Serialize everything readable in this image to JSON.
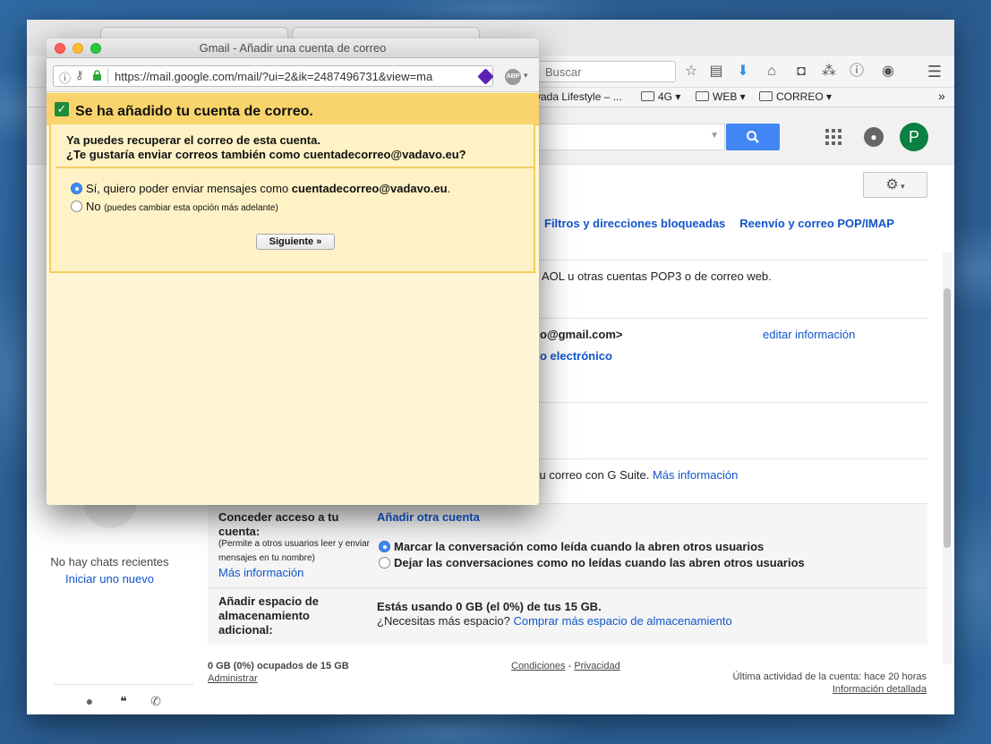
{
  "popup": {
    "title": "Gmail - Añadir una cuenta de correo",
    "url": "https://mail.google.com/mail/?ui=2&ik=2487496731&view=ma",
    "notice": "Se ha añadido tu cuenta de correo.",
    "question_line1": "Ya puedes recuperar el correo de esta cuenta.",
    "question_line2": "¿Te gustaría enviar correos también como cuentadecorreo@vadavo.eu?",
    "option_yes_prefix": "Sí, quiero poder enviar mensajes como ",
    "option_yes_email": "cuentadecorreo@vadavo.eu",
    "option_yes_suffix": ".",
    "option_no": "No",
    "option_no_note": "(puedes cambiar esta opción más adelante)",
    "next_button": "Siguiente »",
    "abp_label": "ABP"
  },
  "browser": {
    "search_placeholder": "Buscar",
    "bookmarks": {
      "item1": "vada Lifestyle – ...",
      "item2": "4G",
      "item3": "WEB",
      "item4": "CORREO"
    },
    "overflow": "»"
  },
  "gmail": {
    "avatar_letter": "P",
    "tabs": {
      "filters": "Filtros y direcciones bloqueadas",
      "forwarding": "Reenvío y correo POP/IMAP"
    },
    "accounts_text": "AOL u otras cuentas POP3 o de correo web.",
    "send_as_email": "o@gmail.com>",
    "edit_info": "editar información",
    "add_address": "o electrónico",
    "gsuite_text": " su correo con G Suite. ",
    "more_info": "Más información",
    "grant_access_label": "Conceder acceso a tu cuenta:",
    "grant_access_note": "(Permite a otros usuarios leer y enviar mensajes en tu nombre)",
    "grant_more_info": "Más información",
    "add_other_account": "Añadir otra cuenta",
    "mark_read": "Marcar la conversación como leída cuando la abren otros usuarios",
    "leave_unread": "Dejar las conversaciones como no leídas cuando las abren otros usuarios",
    "storage_label": "Añadir espacio de almacenamiento adicional:",
    "storage_usage": "Estás usando 0 GB (el 0%) de tus 15 GB.",
    "need_space": "¿Necesitas más espacio? ",
    "buy_space": "Comprar más espacio de almacenamiento",
    "footer_usage": "0 GB (0%) ocupados de 15 GB",
    "footer_manage": "Administrar",
    "footer_terms": "Condiciones",
    "footer_sep": " - ",
    "footer_privacy": "Privacidad",
    "footer_activity": "Última actividad de la cuenta: hace 20 horas",
    "footer_details": "Información detallada"
  },
  "chat": {
    "no_chats": "No hay chats recientes",
    "start_new": "Iniciar uno nuevo"
  }
}
